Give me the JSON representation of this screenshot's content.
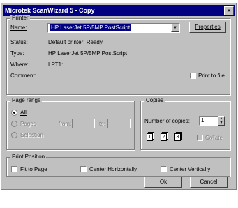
{
  "window": {
    "title": "Microtek ScanWizard 5 - Copy",
    "close_glyph": "×"
  },
  "printer": {
    "group_label": "Printer",
    "name_label": "Name:",
    "name_value": "HP LaserJet 5P/5MP PostScript",
    "properties_label": "Properties",
    "status_label": "Status:",
    "status_value": "Default printer; Ready",
    "type_label": "Type:",
    "type_value": "HP LaserJet 5P/5MP PostScript",
    "where_label": "Where:",
    "where_value": "LPT1:",
    "comment_label": "Comment:",
    "print_to_file_label": "Print to file"
  },
  "page_range": {
    "group_label": "Page range",
    "all_label": "All",
    "pages_label": "Pages",
    "from_label": "from:",
    "to_label": "to:",
    "selection_label": "Selection"
  },
  "copies": {
    "group_label": "Copies",
    "number_label": "Number of copies:",
    "number_value": "1",
    "collate_label": "Collate",
    "page_numbers": [
      "1",
      "2",
      "3"
    ]
  },
  "print_position": {
    "group_label": "Print Position",
    "fit_to_page_label": "Fit to Page",
    "center_h_label": "Center Horizontally",
    "center_v_label": "Center Vertically"
  },
  "buttons": {
    "ok_label": "Ok",
    "cancel_label": "Cancel"
  },
  "colors": {
    "titlebar": "#000080",
    "dialog_face": "#c0c0c0",
    "selection": "#000080"
  }
}
